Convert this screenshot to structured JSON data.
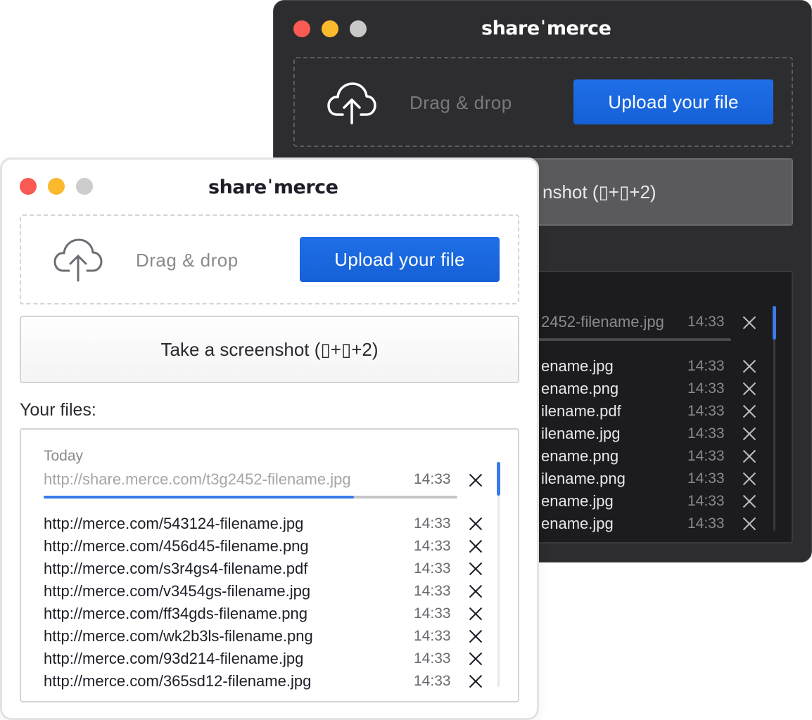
{
  "dark_window": {
    "brand": {
      "left": "share",
      "mark": "'",
      "right": "merce"
    },
    "drag_text": "Drag & drop",
    "upload_label": "Upload your file",
    "screenshot_label": "nshot (▯+▯+2)",
    "pending": {
      "url": "2452-filename.jpg",
      "time": "14:33",
      "progress": 0.42
    },
    "files": [
      {
        "url": "ename.jpg",
        "time": "14:33"
      },
      {
        "url": "ename.png",
        "time": "14:33"
      },
      {
        "url": "ilename.pdf",
        "time": "14:33"
      },
      {
        "url": "ilename.jpg",
        "time": "14:33"
      },
      {
        "url": "ename.png",
        "time": "14:33"
      },
      {
        "url": "ilename.png",
        "time": "14:33"
      },
      {
        "url": "ename.jpg",
        "time": "14:33"
      },
      {
        "url": "ename.jpg",
        "time": "14:33"
      }
    ]
  },
  "light_window": {
    "brand": {
      "left": "share",
      "mark": "'",
      "right": "merce"
    },
    "drag_text": "Drag & drop",
    "upload_label": "Upload your file",
    "screenshot_label": "Take a screenshot (▯+▯+2)",
    "files_heading": "Your files:",
    "group_label": "Today",
    "pending": {
      "url": "http://share.merce.com/t3g2452-filename.jpg",
      "time": "14:33",
      "progress": 0.75
    },
    "files": [
      {
        "url": "http://merce.com/543124-filename.jpg",
        "time": "14:33"
      },
      {
        "url": "http://merce.com/456d45-filename.png",
        "time": "14:33"
      },
      {
        "url": "http://merce.com/s3r4gs4-filename.pdf",
        "time": "14:33"
      },
      {
        "url": "http://merce.com/v3454gs-filename.jpg",
        "time": "14:33"
      },
      {
        "url": "http://merce.com/ff34gds-filename.png",
        "time": "14:33"
      },
      {
        "url": "http://merce.com/wk2b3ls-filename.png",
        "time": "14:33"
      },
      {
        "url": "http://merce.com/93d214-filename.jpg",
        "time": "14:33"
      },
      {
        "url": "http://merce.com/365sd12-filename.jpg",
        "time": "14:33"
      }
    ]
  },
  "colors": {
    "accent": "#1f6fe8",
    "progress": "#3a7bea",
    "close": "#f95a53",
    "minimize": "#fbb92e",
    "zoom": "#cdcdcd"
  },
  "icons": [
    "cloud-upload-icon",
    "close-icon"
  ]
}
